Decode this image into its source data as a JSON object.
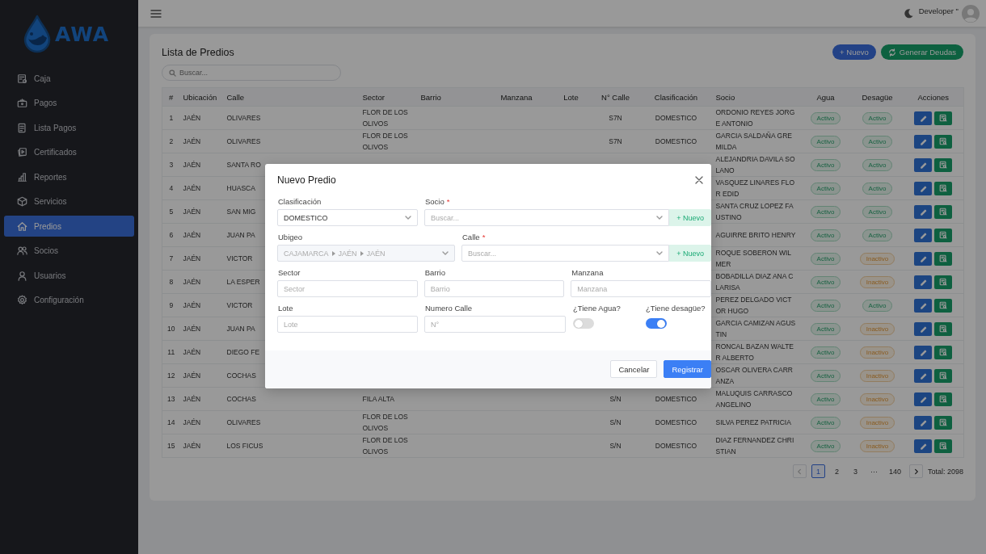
{
  "sidebar": {
    "logo_text": "AWA",
    "items": [
      {
        "label": "Caja",
        "selected": false
      },
      {
        "label": "Pagos",
        "selected": false
      },
      {
        "label": "Lista Pagos",
        "selected": false
      },
      {
        "label": "Certificados",
        "selected": false
      },
      {
        "label": "Reportes",
        "selected": false
      },
      {
        "label": "Servicios",
        "selected": false
      },
      {
        "label": "Predios",
        "selected": true
      },
      {
        "label": "Socios",
        "selected": false
      },
      {
        "label": "Usuarios",
        "selected": false
      },
      {
        "label": "Configuración",
        "selected": false
      }
    ]
  },
  "header": {
    "user": "Developer \""
  },
  "page": {
    "title": "Lista de Predios",
    "buttons": [
      {
        "label": "+ Nuevo",
        "kind": "primary"
      },
      {
        "label": "Generar Deudas",
        "kind": "success"
      }
    ],
    "search": {
      "placeholder": "Buscar..."
    }
  },
  "table": {
    "columns": [
      "#",
      "Ubicación",
      "Calle",
      "Sector",
      "Barrio",
      "Manzana",
      "Lote",
      "N° Calle",
      "Clasificación",
      "Socio",
      "Agua",
      "Desagüe",
      "Acciones"
    ],
    "rows": [
      {
        "n": "1",
        "ubicacion": "JAÉN",
        "calle": "OLIVARES",
        "sector": "FLOR DE LOS OLIVOS",
        "numero": "S7N",
        "clasificacion": "DOMESTICO",
        "socio": "ORDONIO REYES JORGE ANTONIO",
        "agua": {
          "label": "Activo",
          "active": true
        },
        "desague": {
          "label": "Activo",
          "active": true
        }
      },
      {
        "n": "2",
        "ubicacion": "JAÉN",
        "calle": "OLIVARES",
        "sector": "FLOR DE LOS OLIVOS",
        "numero": "S7N",
        "clasificacion": "DOMESTICO",
        "socio": "GARCIA SALDAÑA GREMILDA",
        "agua": {
          "label": "Activo",
          "active": true
        },
        "desague": {
          "label": "Activo",
          "active": true
        }
      },
      {
        "n": "3",
        "ubicacion": "JAÉN",
        "calle": "SANTA RO",
        "socio": "ALEJANDRIA DAVILA SOLANO",
        "agua": {
          "label": "Activo",
          "active": true
        },
        "desague": {
          "label": "Activo",
          "active": true
        }
      },
      {
        "n": "4",
        "ubicacion": "JAÉN",
        "calle": "HUASCA",
        "socio": "VASQUEZ LINARES FLOR EDID",
        "agua": {
          "label": "Activo",
          "active": true
        },
        "desague": {
          "label": "Activo",
          "active": true
        }
      },
      {
        "n": "5",
        "ubicacion": "JAÉN",
        "calle": "SAN MIG",
        "socio": "SANTA CRUZ LOPEZ FAUSTINO",
        "agua": {
          "label": "Activo",
          "active": true
        },
        "desague": {
          "label": "Activo",
          "active": true
        }
      },
      {
        "n": "6",
        "ubicacion": "JAÉN",
        "calle": "JUAN PA",
        "socio": "AGUIRRE BRITO HENRY",
        "agua": {
          "label": "Activo",
          "active": true
        },
        "desague": {
          "label": "Activo",
          "active": true
        }
      },
      {
        "n": "7",
        "ubicacion": "JAÉN",
        "calle": "VICTOR",
        "socio": "ROQUE SOBERON WILMER",
        "agua": {
          "label": "Activo",
          "active": true
        },
        "desague": {
          "label": "Inactivo",
          "active": false
        }
      },
      {
        "n": "8",
        "ubicacion": "JAÉN",
        "calle": "LA ESPER",
        "socio": "BOBADILLA DIAZ ANA CLARISA",
        "agua": {
          "label": "Activo",
          "active": true
        },
        "desague": {
          "label": "Inactivo",
          "active": false
        }
      },
      {
        "n": "9",
        "ubicacion": "JAÉN",
        "calle": "VICTOR",
        "socio": "PEREZ DELGADO VICTOR HUGO",
        "agua": {
          "label": "Activo",
          "active": true
        },
        "desague": {
          "label": "Activo",
          "active": true
        }
      },
      {
        "n": "10",
        "ubicacion": "JAÉN",
        "calle": "JUAN PA",
        "socio": "GARCIA CAMIZAN AGUSTIN",
        "agua": {
          "label": "Activo",
          "active": true
        },
        "desague": {
          "label": "Inactivo",
          "active": false
        }
      },
      {
        "n": "11",
        "ubicacion": "JAÉN",
        "calle": "DIEGO FE",
        "socio": "RONCAL BAZAN WALTER ALBERTO",
        "agua": {
          "label": "Activo",
          "active": true
        },
        "desague": {
          "label": "Inactivo",
          "active": false
        }
      },
      {
        "n": "12",
        "ubicacion": "JAÉN",
        "calle": "COCHAS",
        "socio": "OSCAR OLIVERA CARRANZA",
        "agua": {
          "label": "Activo",
          "active": true
        },
        "desague": {
          "label": "Inactivo",
          "active": false
        }
      },
      {
        "n": "13",
        "ubicacion": "JAÉN",
        "calle": "COCHAS",
        "sector": "FILA ALTA",
        "numero": "S/N",
        "clasificacion": "DOMESTICO",
        "socio": "MALUQUIS CARRASCO ANGELINO",
        "agua": {
          "label": "Activo",
          "active": true
        },
        "desague": {
          "label": "Inactivo",
          "active": false
        }
      },
      {
        "n": "14",
        "ubicacion": "JAÉN",
        "calle": "OLIVARES",
        "sector": "FLOR DE LOS OLIVOS",
        "numero": "S/N",
        "clasificacion": "DOMESTICO",
        "socio": "SILVA PEREZ PATRICIA",
        "agua": {
          "label": "Activo",
          "active": true
        },
        "desague": {
          "label": "Inactivo",
          "active": false
        }
      },
      {
        "n": "15",
        "ubicacion": "JAÉN",
        "calle": "LOS FICUS",
        "sector": "FLOR DE LOS OLIVOS",
        "numero": "S/N",
        "clasificacion": "DOMESTICO",
        "socio": "DIAZ FERNANDEZ CHRISTIAN",
        "agua": {
          "label": "Activo",
          "active": true
        },
        "desague": {
          "label": "Inactivo",
          "active": false
        }
      }
    ]
  },
  "pagination": {
    "prev": {
      "disabled": true
    },
    "next": {
      "disabled": false
    },
    "pages": [
      {
        "label": "1",
        "kind": "page",
        "selected": true
      },
      {
        "label": "2",
        "kind": "page",
        "selected": false
      },
      {
        "label": "3",
        "kind": "page",
        "selected": false
      },
      {
        "label": "···",
        "kind": "ellipsis"
      },
      {
        "label": "140",
        "kind": "page",
        "selected": false
      }
    ],
    "total": "Total: 2098"
  },
  "modal": {
    "title": "Nuevo Predio",
    "rows": [
      [
        {
          "kind": "select",
          "label": "Clasificación",
          "value": "DOMESTICO"
        },
        {
          "kind": "search",
          "label": "Socio",
          "required_mark": "*",
          "placeholder": "Buscar...",
          "add_button": "+ Nuevo"
        }
      ],
      [
        {
          "kind": "cascader",
          "label": "Ubigeo",
          "parts": [
            "CAJAMARCA",
            "JAÉN",
            "JAÉN"
          ],
          "disabled": true
        },
        {
          "kind": "search",
          "label": "Calle",
          "required_mark": "*",
          "placeholder": "Buscar...",
          "add_button": "+ Nuevo"
        }
      ],
      [
        {
          "kind": "input",
          "label": "Sector",
          "placeholder": "Sector"
        },
        {
          "kind": "input",
          "label": "Barrio",
          "placeholder": "Barrio"
        },
        {
          "kind": "input",
          "label": "Manzana",
          "placeholder": "Manzana"
        }
      ],
      [
        {
          "kind": "input",
          "label": "Lote",
          "placeholder": "Lote"
        },
        {
          "kind": "input",
          "label": "Numero Calle",
          "placeholder": "N°"
        },
        {
          "kind": "toggle",
          "label": "¿Tiene Agua?",
          "on": false
        },
        {
          "kind": "toggle",
          "label": "¿Tiene desagüe?",
          "on": true
        }
      ]
    ],
    "buttons": [
      {
        "label": "Cancelar",
        "kind": "secondary"
      },
      {
        "label": "Registrar",
        "kind": "primary"
      }
    ]
  }
}
